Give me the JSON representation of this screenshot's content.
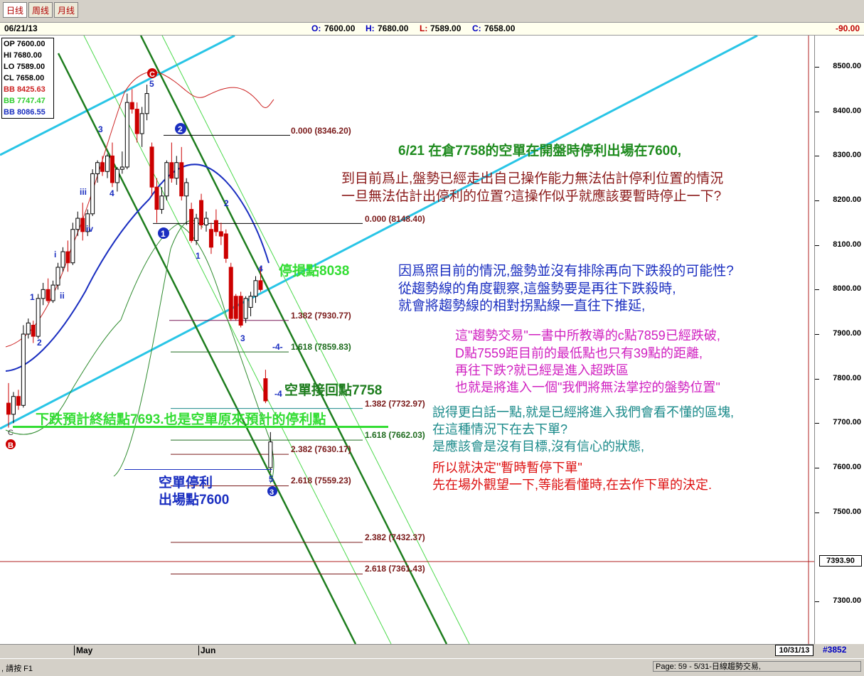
{
  "tabs": [
    {
      "label": "日线"
    },
    {
      "label": "周线"
    },
    {
      "label": "月线"
    }
  ],
  "infobar": {
    "date": "06/21/13",
    "open": "7600.00",
    "high": "7680.00",
    "low": "7589.00",
    "close": "7658.00",
    "change": "-90.00"
  },
  "legend": {
    "op": "OP 7600.00",
    "hi": "HI  7680.00",
    "lo": "LO  7589.00",
    "cl": "CL  7658.00",
    "bb_upper": "BB 8425.63",
    "bb_mid": "BB 7747.47",
    "bb_lower": "BB 8086.55"
  },
  "y_ticks": [
    "8500.00",
    "8400.00",
    "8300.00",
    "8200.00",
    "8100.00",
    "8000.00",
    "7900.00",
    "7800.00",
    "7700.00",
    "7600.00",
    "7500.00",
    "7300.00"
  ],
  "last_value": "7393.90",
  "x_labels": {
    "may": "May",
    "jun": "Jun"
  },
  "end_date": "10/31/13",
  "bar_count": "#3852",
  "status": {
    "help": ", 請按 F1",
    "page": "Page: 59 - 5/31-日線趨勢交易,"
  },
  "colors": {
    "up": "#ffffff",
    "down": "#cc0000",
    "bb_mid": "#1a2ec0",
    "bb_outer_green": "#2e8b2e",
    "bb_red": "#cc2222",
    "channel_cyan": "#29c5e6",
    "channel_green": "#1e7d1e"
  },
  "chart_data": {
    "type": "candlestick",
    "ylim": [
      7200,
      8560
    ],
    "candles": [
      {
        "o": 7745,
        "h": 7790,
        "l": 7690,
        "c": 7720
      },
      {
        "o": 7720,
        "h": 7770,
        "l": 7700,
        "c": 7760
      },
      {
        "o": 7760,
        "h": 7775,
        "l": 7730,
        "c": 7740
      },
      {
        "o": 7740,
        "h": 7920,
        "l": 7735,
        "c": 7900
      },
      {
        "o": 7900,
        "h": 7935,
        "l": 7890,
        "c": 7925
      },
      {
        "o": 7920,
        "h": 7930,
        "l": 7880,
        "c": 7895
      },
      {
        "o": 7895,
        "h": 7990,
        "l": 7890,
        "c": 7980
      },
      {
        "o": 7980,
        "h": 8015,
        "l": 7965,
        "c": 8000
      },
      {
        "o": 8000,
        "h": 8025,
        "l": 7970,
        "c": 7975
      },
      {
        "o": 7975,
        "h": 8020,
        "l": 7970,
        "c": 8010
      },
      {
        "o": 8010,
        "h": 8060,
        "l": 8000,
        "c": 8050
      },
      {
        "o": 8050,
        "h": 8095,
        "l": 8040,
        "c": 8085
      },
      {
        "o": 8085,
        "h": 8110,
        "l": 8040,
        "c": 8060
      },
      {
        "o": 8060,
        "h": 8150,
        "l": 8055,
        "c": 8135
      },
      {
        "o": 8135,
        "h": 8175,
        "l": 8120,
        "c": 8160
      },
      {
        "o": 8160,
        "h": 8195,
        "l": 8110,
        "c": 8130
      },
      {
        "o": 8130,
        "h": 8180,
        "l": 8120,
        "c": 8170
      },
      {
        "o": 8170,
        "h": 8270,
        "l": 8165,
        "c": 8260
      },
      {
        "o": 8260,
        "h": 8290,
        "l": 8240,
        "c": 8285
      },
      {
        "o": 8285,
        "h": 8300,
        "l": 8255,
        "c": 8265
      },
      {
        "o": 8265,
        "h": 8305,
        "l": 8250,
        "c": 8300
      },
      {
        "o": 8300,
        "h": 8330,
        "l": 8230,
        "c": 8240
      },
      {
        "o": 8240,
        "h": 8275,
        "l": 8220,
        "c": 8270
      },
      {
        "o": 8270,
        "h": 8310,
        "l": 8260,
        "c": 8275
      },
      {
        "o": 8275,
        "h": 8440,
        "l": 8270,
        "c": 8420
      },
      {
        "o": 8420,
        "h": 8450,
        "l": 8395,
        "c": 8405
      },
      {
        "o": 8405,
        "h": 8420,
        "l": 8330,
        "c": 8350
      },
      {
        "o": 8350,
        "h": 8410,
        "l": 8320,
        "c": 8395
      },
      {
        "o": 8395,
        "h": 8460,
        "l": 8380,
        "c": 8440
      },
      {
        "o": 8320,
        "h": 8330,
        "l": 8210,
        "c": 8230
      },
      {
        "o": 8230,
        "h": 8250,
        "l": 8150,
        "c": 8180
      },
      {
        "o": 8180,
        "h": 8230,
        "l": 8170,
        "c": 8210
      },
      {
        "o": 8210,
        "h": 8290,
        "l": 8200,
        "c": 8285
      },
      {
        "o": 8285,
        "h": 8330,
        "l": 8240,
        "c": 8250
      },
      {
        "o": 8250,
        "h": 8300,
        "l": 8235,
        "c": 8285
      },
      {
        "o": 8285,
        "h": 8320,
        "l": 8200,
        "c": 8210
      },
      {
        "o": 8210,
        "h": 8250,
        "l": 8145,
        "c": 8240
      },
      {
        "o": 8180,
        "h": 8195,
        "l": 8105,
        "c": 8110
      },
      {
        "o": 8110,
        "h": 8170,
        "l": 8100,
        "c": 8160
      },
      {
        "o": 8200,
        "h": 8215,
        "l": 8135,
        "c": 8145
      },
      {
        "o": 8145,
        "h": 8175,
        "l": 8130,
        "c": 8160
      },
      {
        "o": 8135,
        "h": 8150,
        "l": 8080,
        "c": 8095
      },
      {
        "o": 8155,
        "h": 8180,
        "l": 8120,
        "c": 8130
      },
      {
        "o": 8130,
        "h": 8150,
        "l": 8100,
        "c": 8120
      },
      {
        "o": 8125,
        "h": 8135,
        "l": 8060,
        "c": 8070
      },
      {
        "o": 8050,
        "h": 8060,
        "l": 7930,
        "c": 7935
      },
      {
        "o": 7985,
        "h": 7990,
        "l": 7930,
        "c": 7935
      },
      {
        "o": 7985,
        "h": 7995,
        "l": 7915,
        "c": 7920
      },
      {
        "o": 7935,
        "h": 7985,
        "l": 7925,
        "c": 7980
      },
      {
        "o": 7960,
        "h": 7995,
        "l": 7940,
        "c": 7985
      },
      {
        "o": 7985,
        "h": 8030,
        "l": 7970,
        "c": 8020
      },
      {
        "o": 8020,
        "h": 8050,
        "l": 7995,
        "c": 8000
      },
      {
        "o": 7800,
        "h": 7820,
        "l": 7745,
        "c": 7750
      },
      {
        "o": 7600,
        "h": 7680,
        "l": 7589,
        "c": 7658
      }
    ],
    "fib_levels": [
      {
        "label": "0.000 (8346.20)",
        "value": 8346.2
      },
      {
        "label": "0.000 (8148.40)",
        "value": 8148.4
      },
      {
        "label": "1.382 (7930.77)",
        "value": 7930.77
      },
      {
        "label": "1.618 (7859.83)",
        "value": 7859.83
      },
      {
        "label": "1.382 (7732.97)",
        "value": 7732.97
      },
      {
        "label": "1.618 (7662.03)",
        "value": 7662.03
      },
      {
        "label": "2.382 (7630.17)",
        "value": 7630.17
      },
      {
        "label": "2.618 (7559.23)",
        "value": 7559.23
      },
      {
        "label": "2.382 (7432.37)",
        "value": 7432.37
      },
      {
        "label": "2.618 (7361.43)",
        "value": 7361.43
      }
    ]
  },
  "annotations": {
    "title": "6/21 在倉7758的空單在開盤時停利出場在7600,",
    "para1_l1": "到目前爲止,盤勢已經走出自己操作能力無法估計停利位置的情況",
    "para1_l2": "一旦無法估計出停利的位置?這操作似乎就應該要暫時停止一下?",
    "para2_l1": "因爲照目前的情況,盤勢並沒有排除再向下跌殺的可能性?",
    "para2_l2": "從趨勢線的角度觀察,這盤勢要是再往下跌殺時,",
    "para2_l3": "就會將趨勢線的相對拐點線一直往下推延,",
    "para3_l1": "這\"趨勢交易\"一書中所教導的c點7859已經跌破,",
    "para3_l2": "D點7559距目前的最低點也只有39點的距離,",
    "para3_l3": "再往下跌?就已經是進入超跌區",
    "para3_l4": "也就是將進入一個\"我們將無法掌控的盤勢位置\"",
    "para4_l1": "說得更白話一點,就是已經將進入我們會看不懂的區塊,",
    "para4_l2": "在這種情況下在去下單?",
    "para4_l3": "是應該會是沒有目標,沒有信心的狀態,",
    "para5_l1": "所以就決定\"暫時暫停下單\"",
    "para5_l2": "先在場外觀望一下,等能看懂時,在去作下單的決定.",
    "stop_loss": "停損點8038",
    "rebound": "空單接回點7758",
    "expected_end": "下跌預計終結點7693.也是空單原來預計的停利點",
    "exit_l1": "空單停利",
    "exit_l2": "出場點7600",
    "point_b": "B",
    "point_c": "C",
    "point_c_small": "C"
  },
  "wave_labels": {
    "w1": "1",
    "w2": "2",
    "wi": "i",
    "wii": "ii",
    "wiii": "iii",
    "wiv": "iv",
    "w3": "3",
    "w4": "4",
    "w5": "5",
    "b2": "2",
    "b1": "1",
    "s1": "1",
    "s2": "2",
    "s3": "3",
    "s4": "4",
    "sm4a": "-4-",
    "sm4b": "-4",
    "s5": "5",
    "b3": "3"
  }
}
